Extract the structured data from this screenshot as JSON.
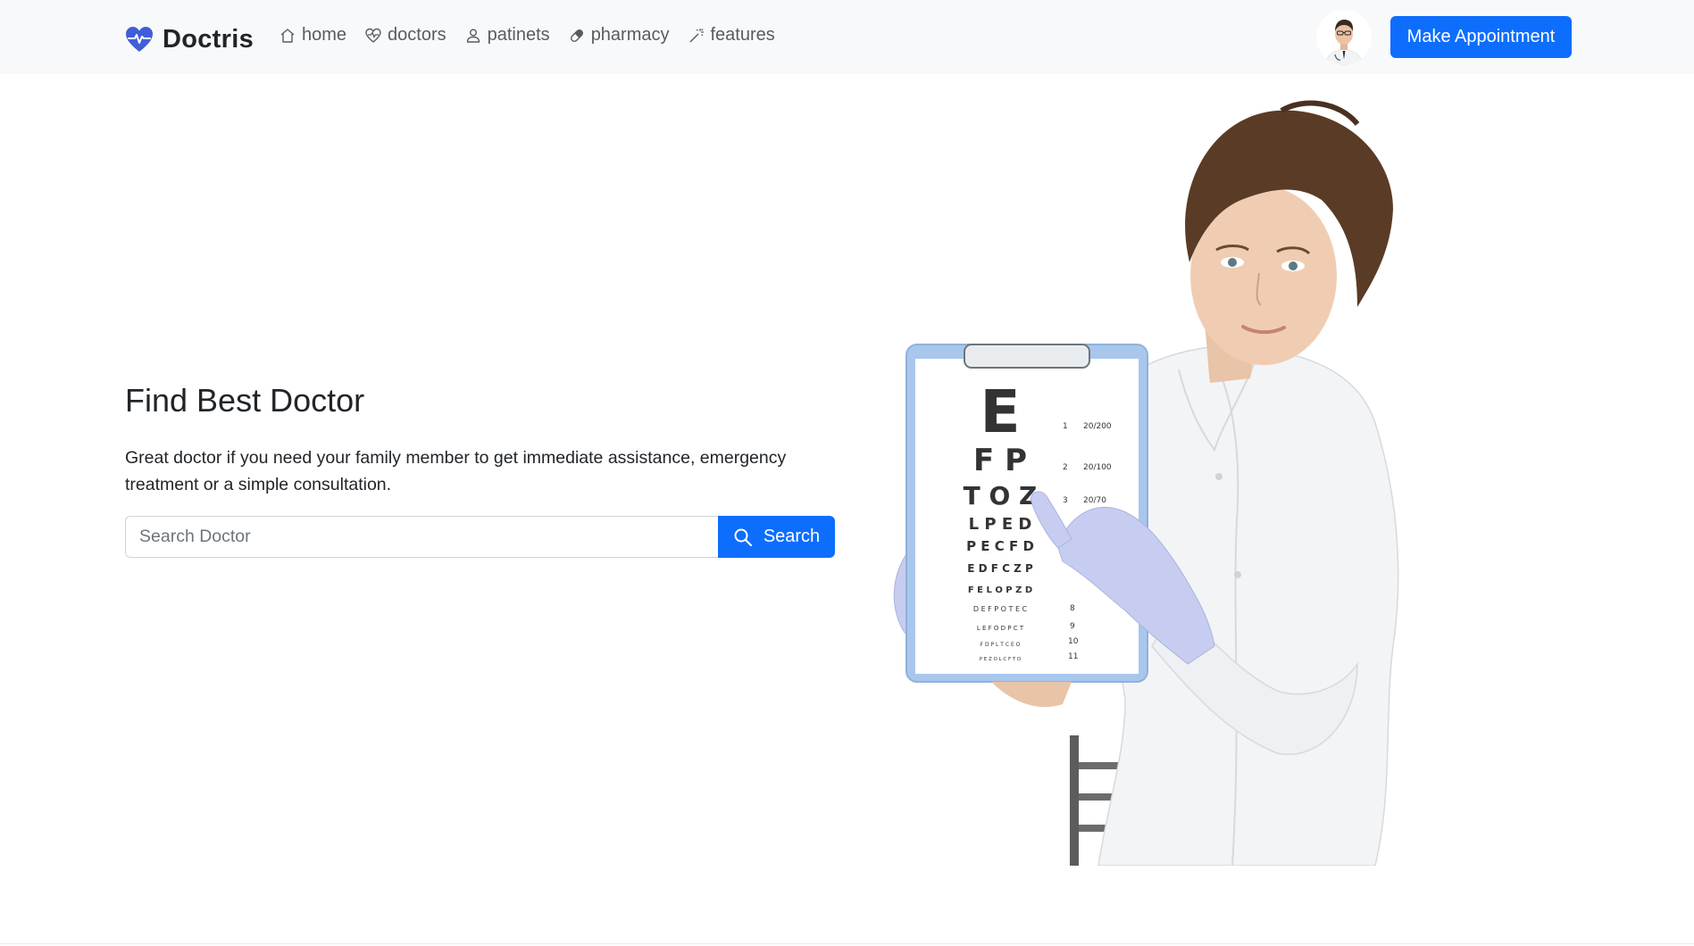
{
  "navbar": {
    "brand": "Doctris",
    "links": [
      {
        "label": "home",
        "icon": "home-icon"
      },
      {
        "label": "doctors",
        "icon": "heart-pulse-icon"
      },
      {
        "label": "patinets",
        "icon": "person-icon"
      },
      {
        "label": "pharmacy",
        "icon": "capsule-icon"
      },
      {
        "label": "features",
        "icon": "magic-wand-icon"
      }
    ],
    "cta_label": "Make Appointment"
  },
  "hero": {
    "title": "Find Best Doctor",
    "description": "Great doctor if you need your family member to get immediate assistance, emergency treatment or a simple consultation.",
    "search_placeholder": "Search Doctor",
    "search_button": "Search"
  },
  "eye_chart": {
    "rows": [
      "E",
      "F P",
      "T O Z",
      "L P E D",
      "P E C F D",
      "E D F C Z P",
      "F E L O P Z D",
      "D E F P O T E C",
      "L E F O D P C T",
      "F D P L T C E O",
      "P E Z O L C F T D"
    ],
    "acuity": [
      "20/200",
      "20/100",
      "20/70"
    ],
    "line_numbers": [
      "1",
      "2",
      "3",
      "8",
      "9",
      "10",
      "11"
    ]
  },
  "colors": {
    "primary": "#0d6efd",
    "navbar_bg": "#f8f9fa",
    "brand_heart": "#3f5ed8"
  }
}
